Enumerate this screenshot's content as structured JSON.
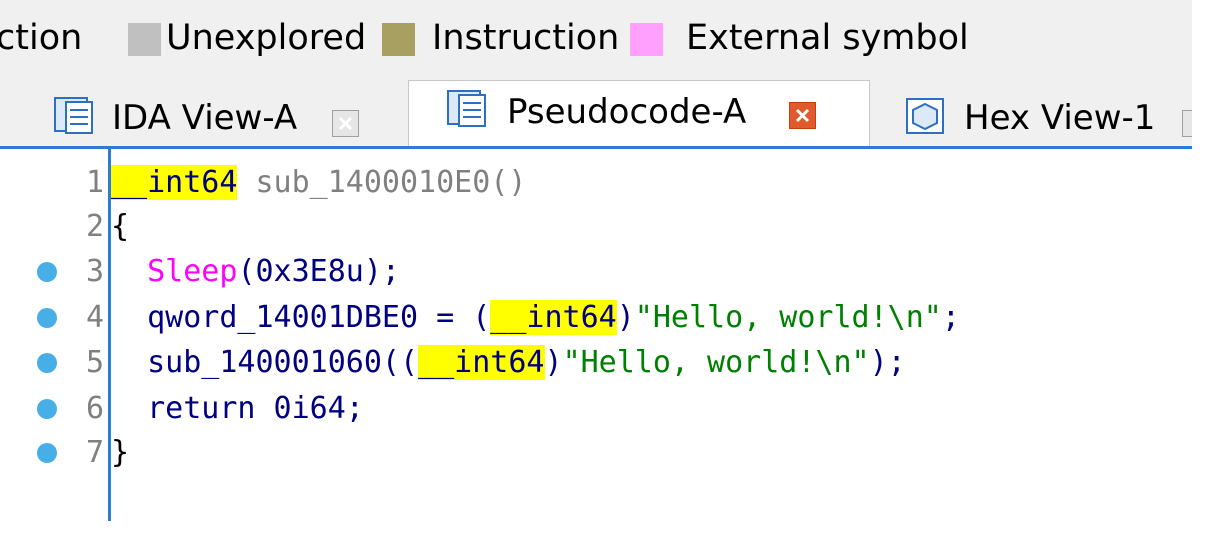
{
  "legend": {
    "items": [
      {
        "label": "ction",
        "color": ""
      },
      {
        "label": "Unexplored",
        "color": "#c0c0c0"
      },
      {
        "label": "Instruction",
        "color": "#a8a060"
      },
      {
        "label": "External symbol",
        "color": "#ffa0ff"
      }
    ]
  },
  "tabs": [
    {
      "label": "IDA View-A",
      "active": false
    },
    {
      "label": "Pseudocode-A",
      "active": true
    },
    {
      "label": "Hex View-1",
      "active": false
    }
  ],
  "code": {
    "line_numbers": [
      "1",
      "2",
      "3",
      "4",
      "5",
      "6",
      "7"
    ],
    "breakpoint_lines": [
      3,
      4,
      5,
      6,
      7
    ],
    "line1": {
      "type": "__int64",
      "name": " sub_1400010E0()"
    },
    "line2": {
      "text": "{"
    },
    "line3": {
      "call": "Sleep",
      "args": "(0x3E8u);"
    },
    "line4": {
      "lhs": "qword_14001DBE0 = (",
      "cast": "__int64",
      "close": ")",
      "str": "\"Hello, world!\\n\"",
      "end": ";"
    },
    "line5": {
      "call": "sub_140001060((",
      "cast": "__int64",
      "close": ")",
      "str": "\"Hello, world!\\n\"",
      "end": ");"
    },
    "line6": {
      "text": "return 0i64;"
    },
    "line7": {
      "text": "}"
    }
  },
  "colors": {
    "accent": "#2d7bd6",
    "highlight": "#ffff00",
    "breakpoint_dot": "#48aee8",
    "string": "#008000",
    "api": "#ff00ff",
    "keyword": "#000080"
  }
}
